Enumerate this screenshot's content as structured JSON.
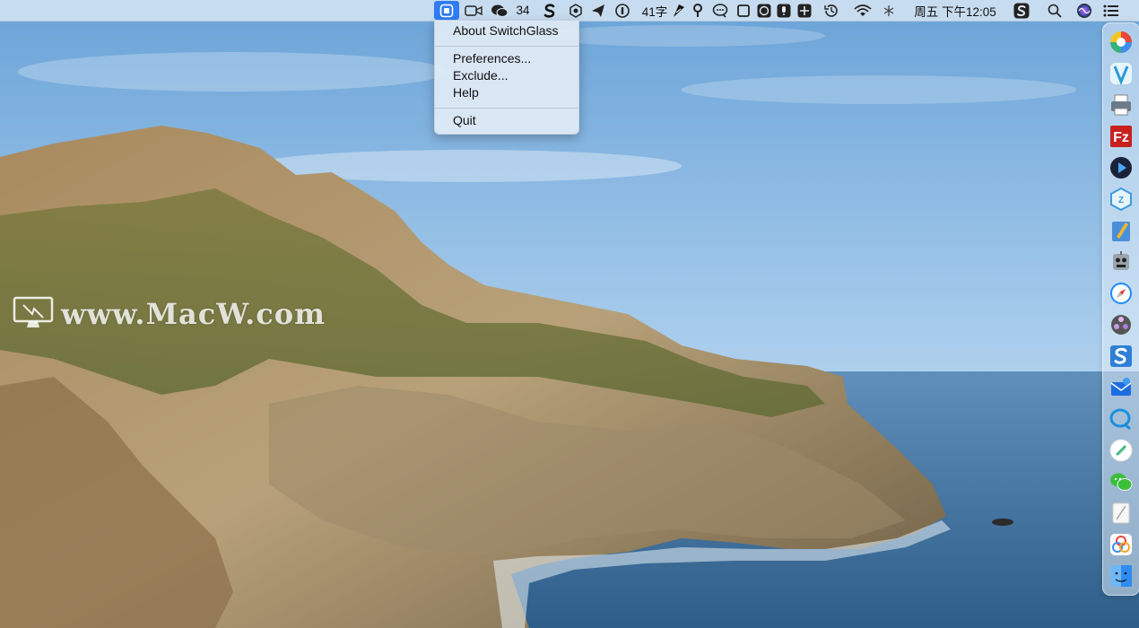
{
  "menubar": {
    "switchglass_icon": "switchglass-status-icon",
    "wechat_count": "34",
    "word_count": "41字",
    "datetime": "周五 下午12:05",
    "status_icons": [
      "facetime-icon",
      "wechat-icon",
      "scrivener-s-icon",
      "hexagon-icon",
      "paper-plane-icon",
      "onepassword-icon",
      "feather-icon",
      "p-icon",
      "chat-bubble-icon",
      "square-icon",
      "face-icon",
      "microphone-icon",
      "grid-icon",
      "time-machine-icon",
      "wifi-icon",
      "asterisk-icon",
      "scrivener-icon",
      "search-icon",
      "siri-icon",
      "control-center-icon"
    ]
  },
  "dropdown": {
    "items": [
      {
        "label": "About SwitchGlass"
      },
      {
        "label": "Preferences..."
      },
      {
        "label": "Exclude..."
      },
      {
        "label": "Help"
      },
      {
        "label": "Quit"
      }
    ]
  },
  "watermark": {
    "text": "www.MacW.com"
  },
  "dock": {
    "apps": [
      "color-wheel-app-icon",
      "vectorize-app-icon",
      "printer-app-icon",
      "filezilla-app-icon",
      "video-player-app-icon",
      "compressor-app-icon",
      "pages-pen-app-icon",
      "automator-robot-app-icon",
      "safari-app-icon",
      "movie-reel-app-icon",
      "scrivener-app-icon",
      "mail-app-icon",
      "chat-app-icon",
      "feather-app-icon",
      "wechat-app-icon",
      "notes-app-icon",
      "photos-app-icon",
      "finder-app-icon"
    ]
  },
  "colors": {
    "accent": "#2f7cf6",
    "sky": "#8fbde6",
    "sea": "#3d6f98"
  }
}
